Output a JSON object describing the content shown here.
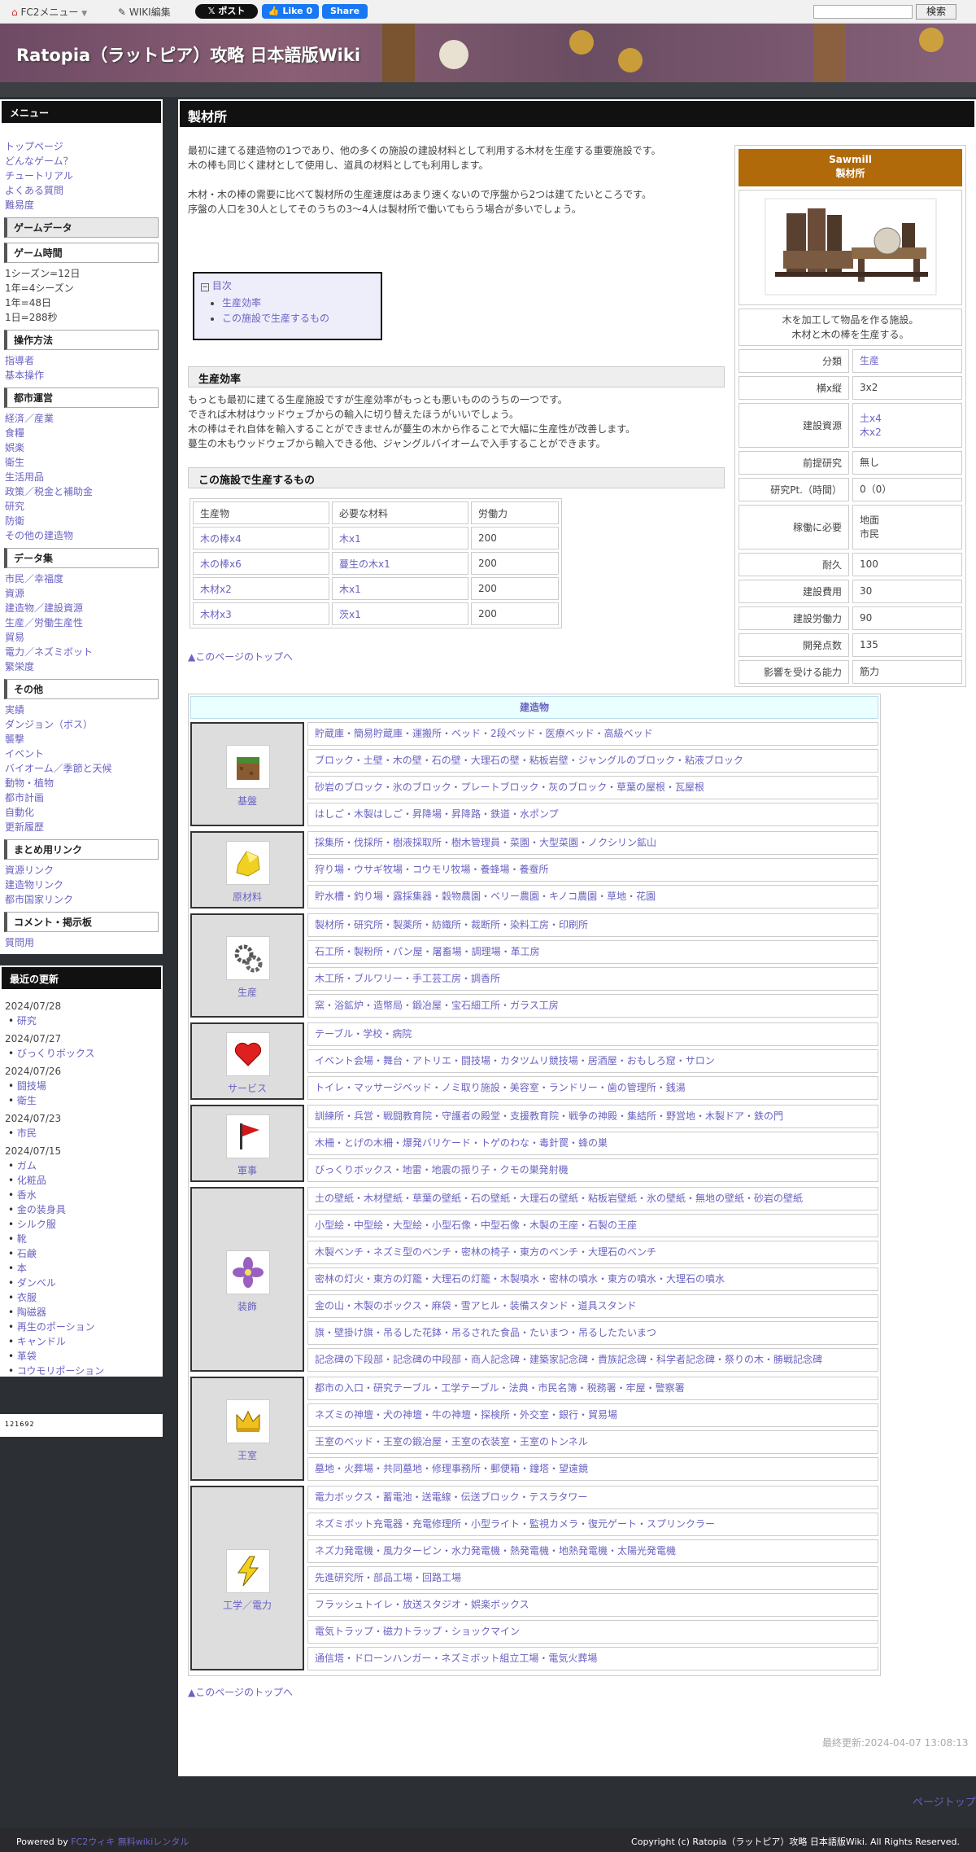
{
  "topbar": {
    "fc2_menu": "FC2メニュー",
    "wiki_edit": "WIKI編集",
    "post": "𝕏 ポスト",
    "like": "👍 Like 0",
    "share": "Share",
    "search_button": "検索"
  },
  "site_title": "Ratopia（ラットピア）攻略 日本語版Wiki",
  "sidebar": {
    "menu_title": "メニュー",
    "top_links": [
      "トップページ",
      "どんなゲーム？",
      "チュートリアル",
      "よくある質問",
      "難易度"
    ],
    "sec_game_data": "ゲームデータ",
    "sec_game_time": "ゲーム時間",
    "game_time_lines": [
      "1シーズン=12日",
      "1年=4シーズン",
      "1年=48日",
      "1日=288秒"
    ],
    "sec_controls": "操作方法",
    "controls_links": [
      "指導者",
      "基本操作"
    ],
    "sec_city": "都市運営",
    "city_links": [
      "経済／産業",
      "食糧",
      "娯楽",
      "衛生",
      "生活用品",
      "政策／税金と補助金",
      "研究",
      "防衛",
      "その他の建造物"
    ],
    "sec_data": "データ集",
    "data_links": [
      "市民／幸福度",
      "資源",
      "建造物／建設資源",
      "生産／労働生産性",
      "貿易",
      "電力／ネズミボット",
      "繁栄度"
    ],
    "sec_other": "その他",
    "other_links": [
      "実績",
      "ダンジョン（ボス）",
      "襲撃",
      "イベント",
      "バイオーム／季節と天候",
      "動物・植物",
      "都市計画",
      "自動化",
      "更新履歴"
    ],
    "sec_links": "まとめ用リンク",
    "links_links": [
      "資源リンク",
      "建造物リンク",
      "都市国家リンク"
    ],
    "sec_comment": "コメント・掲示板",
    "comment_links": [
      "質問用"
    ]
  },
  "recent": {
    "title": "最近の更新",
    "groups": [
      {
        "date": "2024/07/28",
        "items": [
          "研究"
        ]
      },
      {
        "date": "2024/07/27",
        "items": [
          "びっくりボックス"
        ]
      },
      {
        "date": "2024/07/26",
        "items": [
          "闘技場",
          "衛生"
        ]
      },
      {
        "date": "2024/07/23",
        "items": [
          "市民"
        ]
      },
      {
        "date": "2024/07/15",
        "items": [
          "ガム",
          "化粧品",
          "香水",
          "金の装身具",
          "シルク服",
          "靴",
          "石鹸",
          "本",
          "ダンベル",
          "衣服",
          "陶磁器",
          "再生のポーション",
          "キャンドル",
          "革袋",
          "コウモリポーション"
        ]
      }
    ]
  },
  "counter": "121692",
  "page": {
    "title": "製材所",
    "intro1": "最初に建てる建造物の1つであり、他の多くの施設の建設材料として利用する木材を生産する重要施設です。",
    "intro2": "木の棒も同じく建材として使用し、道具の材料としても利用します。",
    "intro3": "木材・木の棒の需要に比べて製材所の生産速度はあまり速くないので序盤から2つは建てたいところです。",
    "intro4": "序盤の人口を30人としてそのうちの3〜4人は製材所で働いてもらう場合が多いでしょう。",
    "toc_label": "目次",
    "toc_items": [
      "生産効率",
      "この施設で生産するもの"
    ],
    "sec1_title": "生産効率",
    "sec1_lines": [
      "もっとも最初に建てる生産施設ですが生産効率がもっとも悪いもののうちの一つです。",
      "できれば木材はウッドウェブからの輸入に切り替えたほうがいいでしょう。",
      "木の棒はそれ自体を輸入することができませんが蔓生の木から作ることで大幅に生産性が改善します。",
      "蔓生の木もウッドウェブから輸入できる他、ジャングルバイオームで入手することができます。"
    ],
    "sec2_title": "この施設で生産するもの",
    "table_headers": [
      "生産物",
      "必要な材料",
      "労働力"
    ],
    "table_rows": [
      [
        "木の棒x4",
        "木x1",
        "200"
      ],
      [
        "木の棒x6",
        "蔓生の木x1",
        "200"
      ],
      [
        "木材x2",
        "木x1",
        "200"
      ],
      [
        "木材x3",
        "茨x1",
        "200"
      ]
    ],
    "back_to_top": "▲このページのトップへ",
    "last_updated": "最終更新:2024-04-07 13:08:13"
  },
  "infobox": {
    "name_en": "Sawmill",
    "name_ja": "製材所",
    "desc1": "木を加工して物品を作る施設。",
    "desc2": "木材と木の棒を生産する。",
    "rows": [
      {
        "k": "分類",
        "v": [
          "生産"
        ]
      },
      {
        "k": "横x縦",
        "v": [
          "3x2"
        ]
      },
      {
        "k": "建設資源",
        "v": [
          "土x4",
          "木x2"
        ]
      },
      {
        "k": "前提研究",
        "v": [
          "無し"
        ]
      },
      {
        "k": "研究Pt.（時間）",
        "v": [
          "0（0）"
        ]
      },
      {
        "k": "稼働に必要",
        "v": [
          "地面",
          "市民"
        ]
      },
      {
        "k": "耐久",
        "v": [
          "100"
        ]
      },
      {
        "k": "建設費用",
        "v": [
          "30"
        ]
      },
      {
        "k": "建設労働力",
        "v": [
          "90"
        ]
      },
      {
        "k": "開発点数",
        "v": [
          "135"
        ]
      },
      {
        "k": "影響を受ける能力",
        "v": [
          "筋力"
        ]
      }
    ]
  },
  "buildings": {
    "title": "建造物",
    "categories": [
      {
        "label": "基盤",
        "icon": "dirt-block-icon",
        "rows": [
          "貯蔵庫・簡易貯蔵庫・運搬所・ベッド・2段ベッド・医療ベッド・高級ベッド",
          "ブロック・土壁・木の壁・石の壁・大理石の壁・粘板岩壁・ジャングルのブロック・粘液ブロック",
          "砂岩のブロック・氷のブロック・プレートブロック・灰のブロック・草葉の屋根・瓦屋根",
          "はしご・木製はしご・昇降場・昇降路・鉄道・水ポンプ"
        ]
      },
      {
        "label": "原材料",
        "icon": "gold-ore-icon",
        "rows": [
          "採集所・伐採所・樹液採取所・樹木管理員・菜園・大型菜園・ノクシリン鉱山",
          "狩り場・ウサギ牧場・コウモリ牧場・養蜂場・養蚕所",
          "貯水槽・釣り場・露採集器・穀物農園・ベリー農園・キノコ農園・草地・花園"
        ]
      },
      {
        "label": "生産",
        "icon": "gears-icon",
        "rows": [
          "製材所・研究所・製薬所・紡織所・裁断所・染料工房・印刷所",
          "石工所・製粉所・パン屋・屠畜場・調理場・革工房",
          "木工所・ブルワリー・手工芸工房・調香所",
          "窯・浴鉱炉・造幣局・鍛冶屋・宝石細工所・ガラス工房"
        ]
      },
      {
        "label": "サービス",
        "icon": "heart-icon",
        "rows": [
          "テーブル・学校・病院",
          "イベント会場・舞台・アトリエ・闘技場・カタツムリ競技場・居酒屋・おもしろ窟・サロン",
          "トイレ・マッサージベッド・ノミ取り施設・美容室・ランドリー・歯の管理所・銭湯"
        ]
      },
      {
        "label": "軍事",
        "icon": "red-flag-icon",
        "rows": [
          "訓練所・兵営・戦闘教育院・守護者の殿堂・支援教育院・戦争の神殿・集結所・野営地・木製ドア・鉄の門",
          "木柵・とげの木柵・爆発バリケード・トゲのわな・毒針罠・蜂の巣",
          "びっくりボックス・地雷・地震の振り子・クモの巣発射機"
        ]
      },
      {
        "label": "装飾",
        "icon": "purple-flower-icon",
        "rows": [
          "土の壁紙・木材壁紙・草葉の壁紙・石の壁紙・大理石の壁紙・粘板岩壁紙・氷の壁紙・無地の壁紙・砂岩の壁紙",
          "小型絵・中型絵・大型絵・小型石像・中型石像・木製の王座・石製の王座",
          "木製ベンチ・ネズミ型のベンチ・密林の椅子・東方のベンチ・大理石のベンチ",
          "密林の灯火・東方の灯籠・大理石の灯籠・木製噴水・密林の噴水・東方の噴水・大理石の噴水",
          "金の山・木製のボックス・麻袋・雪アヒル・装備スタンド・道具スタンド",
          "旗・壁掛け旗・吊るした花鉢・吊るされた食品・たいまつ・吊るしたたいまつ",
          "記念碑の下段部・記念碑の中段部・商人記念碑・建築家記念碑・貴族記念碑・科学者記念碑・祭りの木・勝戦記念碑"
        ]
      },
      {
        "label": "王室",
        "icon": "crown-icon",
        "rows": [
          "都市の入口・研究テーブル・工学テーブル・法典・市民名簿・税務署・牢屋・警察署",
          "ネズミの神壇・犬の神壇・牛の神壇・探検所・外交室・銀行・貿易場",
          "王室のベッド・王室の鍛冶屋・王室の衣装室・王室のトンネル",
          "墓地・火葬場・共同墓地・修理事務所・郵便箱・鐘塔・望遠鏡"
        ]
      },
      {
        "label": "工学／電力",
        "icon": "lightning-icon",
        "rows": [
          "電力ボックス・蓄電池・送電線・伝送ブロック・テスラタワー",
          "ネズミボット充電器・充電修理所・小型ライト・監視カメラ・復元ゲート・スプリンクラー",
          "ネズ力発電機・風力タービン・水力発電機・熱発電機・地熱発電機・太陽光発電機",
          "先進研究所・部品工場・回路工場",
          "フラッシュトイレ・放送スタジオ・娯楽ボックス",
          "電気トラップ・磁力トラップ・ショックマイン",
          "通信塔・ドローンハンガー・ネズミボット組立工場・電気火葬場"
        ]
      }
    ]
  },
  "page_top": "ページトップ",
  "footer": {
    "powered": "Powered by",
    "fc2_link": "FC2ウィキ 無料wikiレンタル",
    "copyright": "Copyright (c) Ratopia（ラットピア）攻略 日本語版Wiki. All Rights Reserved."
  }
}
